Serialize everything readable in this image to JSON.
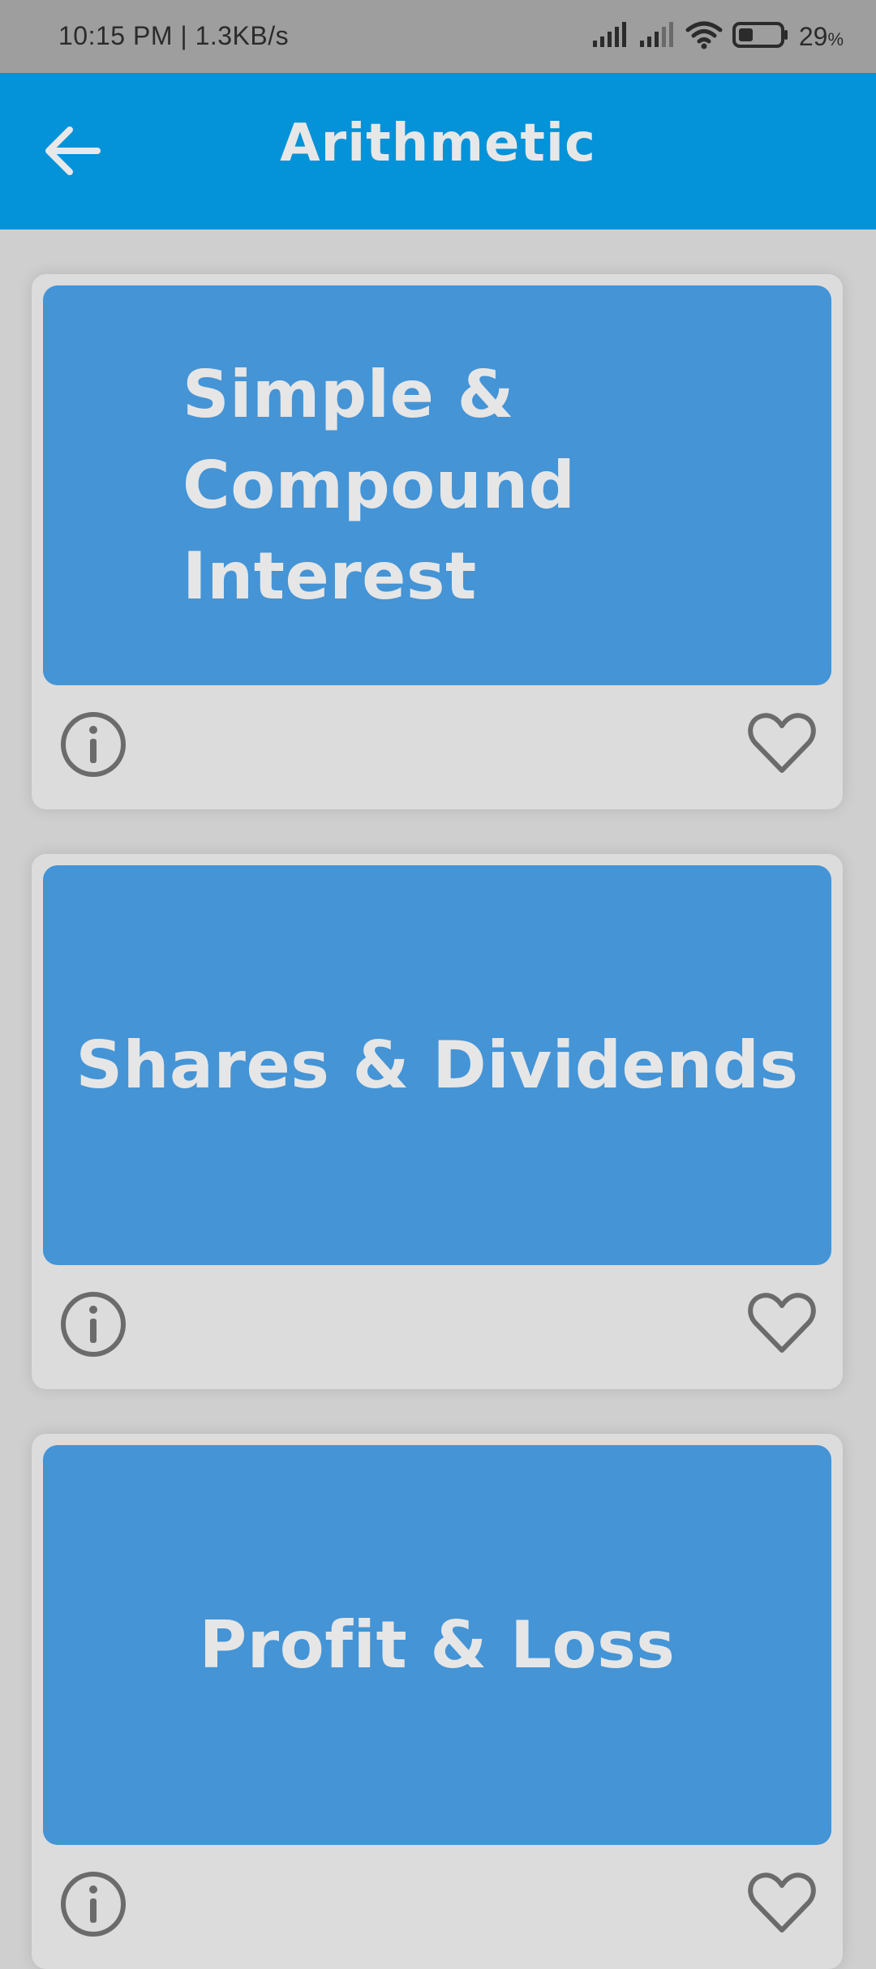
{
  "status_bar": {
    "time_speed": "10:15 PM | 1.3KB/s",
    "battery_percent": "29",
    "battery_unit": "%",
    "icons": [
      "signal-icon",
      "signal-icon",
      "wifi-icon",
      "battery-icon"
    ]
  },
  "app_bar": {
    "title": "Arithmetic",
    "back_icon": "arrow-left-icon"
  },
  "cards": [
    {
      "title_line1": "Simple &",
      "title_line2": "Compound Interest",
      "info_icon": "info-icon",
      "favorite_icon": "heart-icon"
    },
    {
      "title": "Shares & Dividends",
      "info_icon": "info-icon",
      "favorite_icon": "heart-icon"
    },
    {
      "title": "Profit & Loss",
      "info_icon": "info-icon",
      "favorite_icon": "heart-icon"
    }
  ],
  "colors": {
    "app_bar": "#0492d8",
    "card_banner": "#4494d6",
    "card_background": "#dcdcdc",
    "page_background": "#cfcfcf",
    "status_bar": "#9e9e9e"
  }
}
